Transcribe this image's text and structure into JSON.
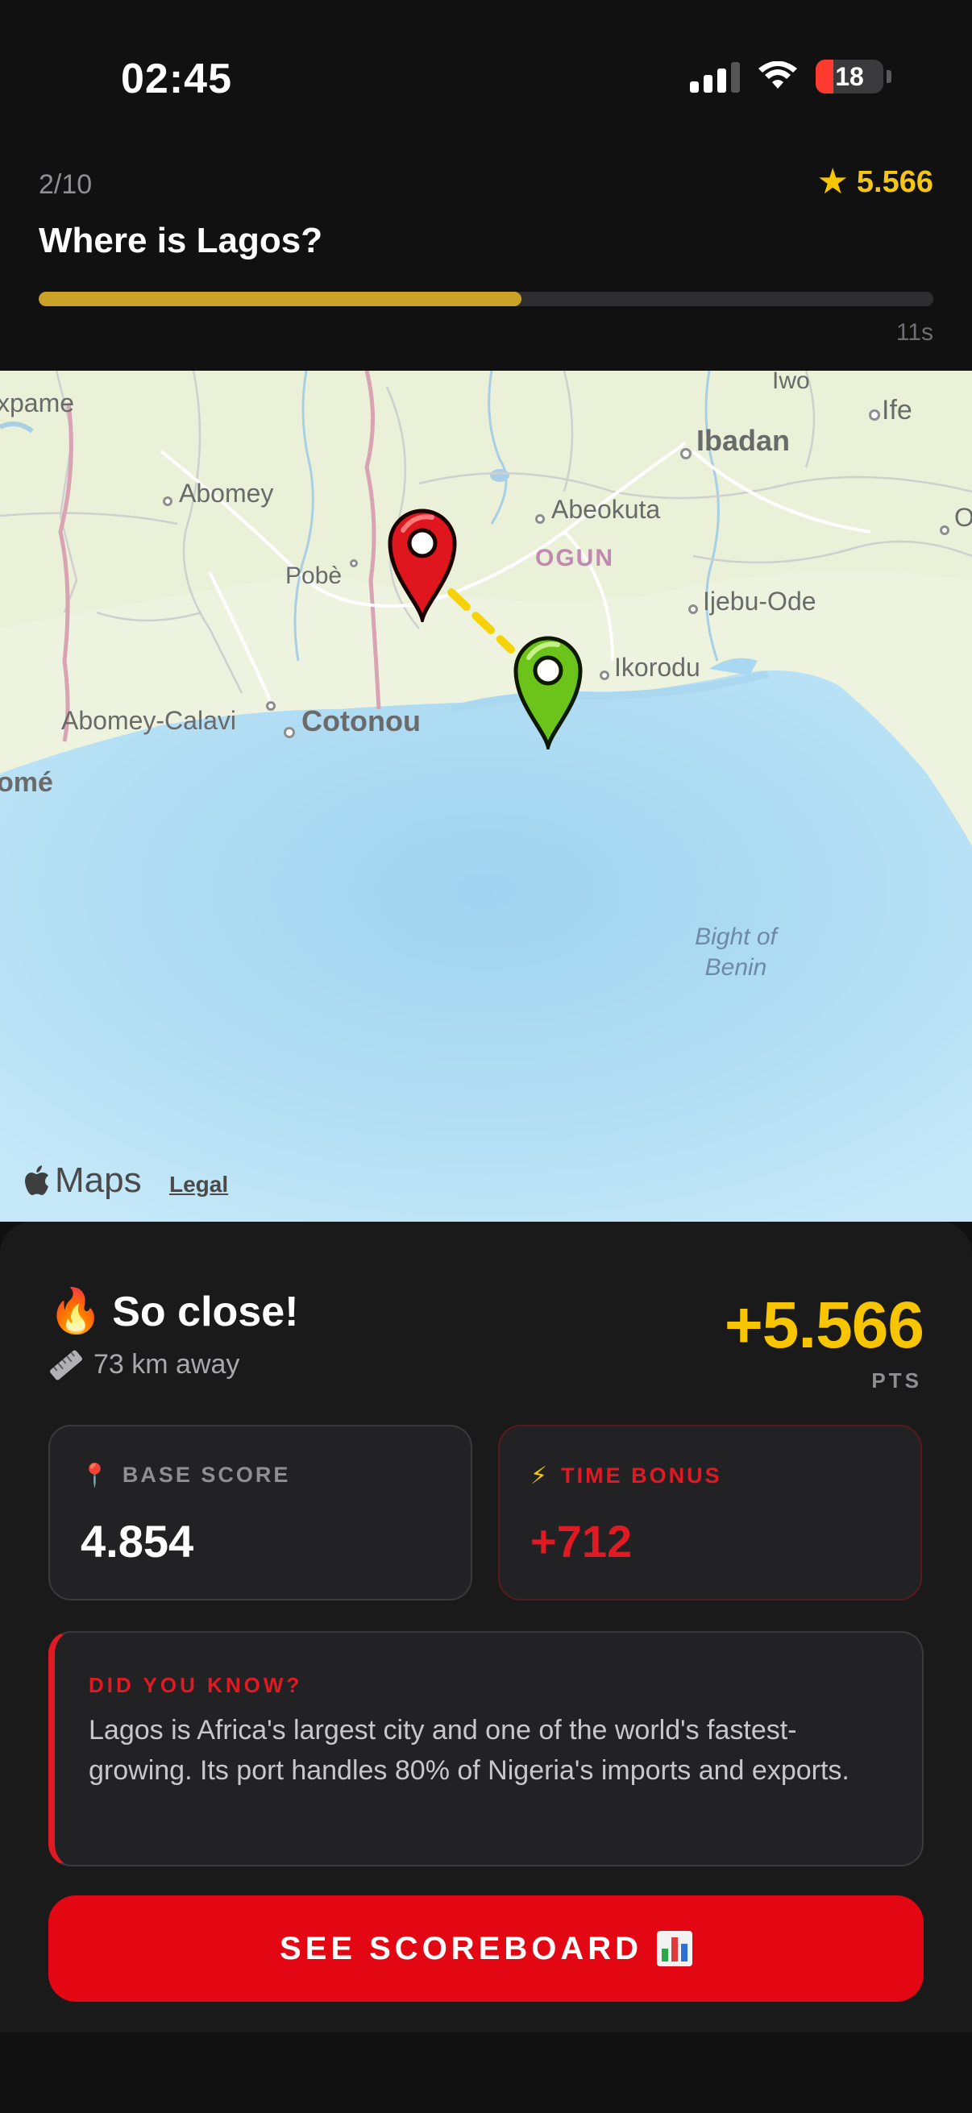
{
  "status_bar": {
    "time": "02:45",
    "battery": "18",
    "icons": [
      "signal-icon",
      "wifi-icon",
      "battery-icon"
    ]
  },
  "header": {
    "progress": "2/10",
    "question": "Where is Lagos?",
    "total_score": "5.566",
    "timer_remaining": "11s",
    "timer_fraction": 0.54,
    "icons": {
      "score": "star-icon"
    }
  },
  "map": {
    "labels": {
      "kpame": "xpame",
      "iwo": "Iwo",
      "ife": "Ife",
      "ibadan": "Ibadan",
      "abomey": "Abomey",
      "abeokuta": "Abeokuta",
      "o": "O",
      "pobe": "Pobè",
      "ogun": "OGUN",
      "ijebu_ode": "Ijebu-Ode",
      "ikorodu": "Ikorodu",
      "abomey_calavi": "Abomey-Calavi",
      "cotonou": "Cotonou",
      "lome": "omé",
      "bight_1": "Bight of",
      "bight_2": "Benin"
    },
    "attribution": "Maps",
    "legal": "Legal",
    "pins": {
      "guess": "red-pin-icon",
      "answer": "green-pin-icon"
    },
    "colors": {
      "guess_pin": "#e0161e",
      "answer_pin": "#6cc41a",
      "line": "#f5d20a",
      "sea": "#bfe6f7",
      "land": "#eef3df"
    }
  },
  "result": {
    "title": "So close!",
    "distance": "73 km away",
    "points": "+5.566",
    "points_unit": "PTS",
    "base_score": {
      "label": "BASE SCORE",
      "value": "4.854"
    },
    "time_bonus": {
      "label": "TIME BONUS",
      "value": "+712"
    },
    "fact": {
      "label": "DID YOU KNOW?",
      "text": "Lagos is Africa's largest city and one of the world's fastest-growing. Its port handles 80% of Nigeria's imports and exports."
    },
    "cta_label": "SEE SCOREBOARD",
    "colors": {
      "accent": "#e30613",
      "gold": "#f7c600"
    },
    "icons": [
      "fire-icon",
      "ruler-icon",
      "map-pin-icon",
      "bolt-icon",
      "bar-chart-icon"
    ]
  }
}
